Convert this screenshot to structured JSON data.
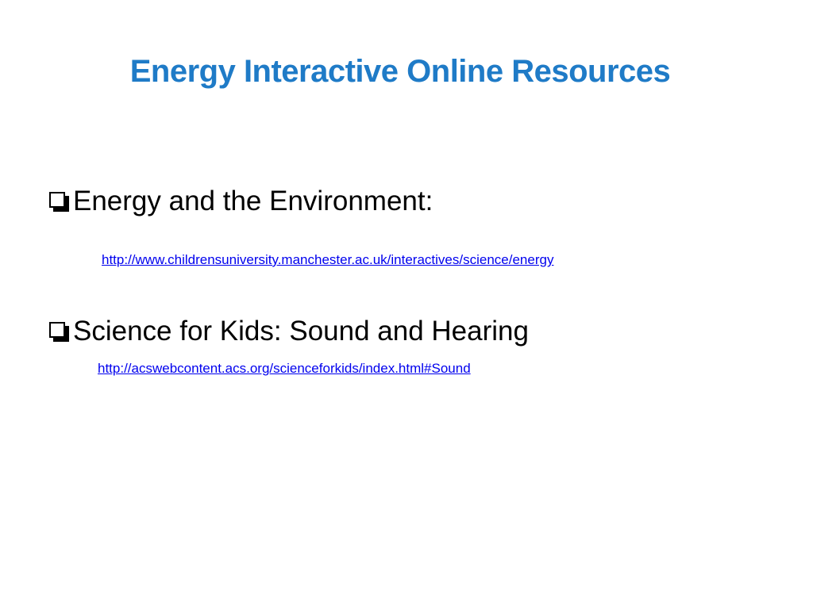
{
  "colors": {
    "title": "#1F7BC7",
    "text": "#000000",
    "link": "#0000EE"
  },
  "slide": {
    "title": "Energy Interactive Online Resources",
    "items": [
      {
        "icon": "checkbox-icon",
        "label": "Energy and the Environment:",
        "url": "http://www.childrensuniversity.manchester.ac.uk/interactives/science/energy"
      },
      {
        "icon": "checkbox-icon",
        "label": "Science for Kids:  Sound and Hearing",
        "url": "http://acswebcontent.acs.org/scienceforkids/index.html#Sound"
      }
    ]
  }
}
